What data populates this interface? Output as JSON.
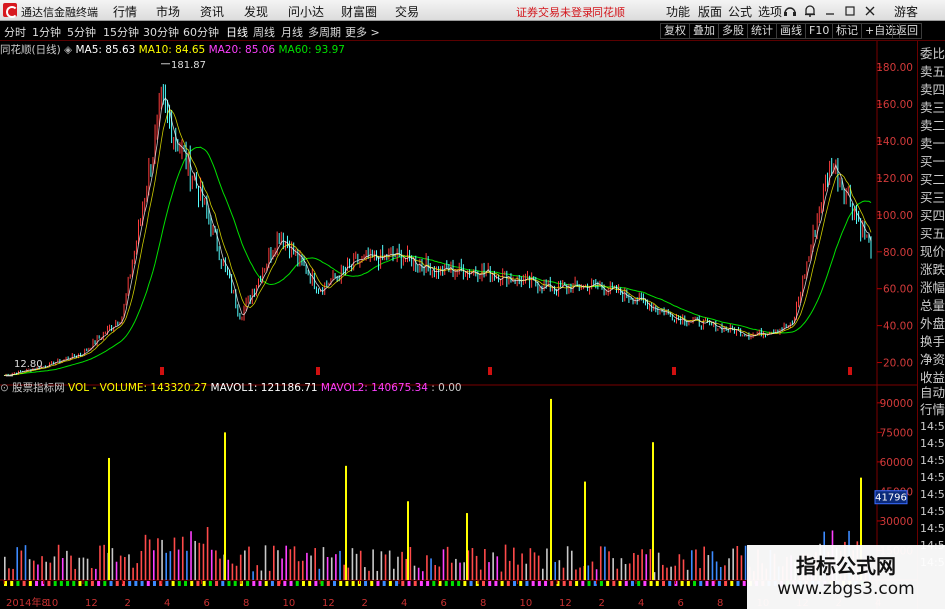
{
  "titlebar": {
    "app_name": "通达信金融终端",
    "menus": [
      "行情",
      "市场",
      "资讯",
      "发现",
      "问小达",
      "财富圈",
      "交易"
    ],
    "warning": "证券交易未登录",
    "warning_right": "同花顺",
    "right_items": [
      "功能",
      "版面",
      "公式",
      "选项"
    ],
    "guest": "游客"
  },
  "toolbar": {
    "periods": [
      "分时",
      "1分钟",
      "5分钟",
      "15分钟",
      "30分钟",
      "60分钟",
      "日线",
      "周线",
      "月线",
      "多周期",
      "更多 >"
    ],
    "active_period": "日线",
    "right_buttons": [
      "复权",
      "叠加",
      "多股",
      "统计",
      "画线",
      "F10",
      "标记",
      "+自选",
      "返回"
    ]
  },
  "main_info": {
    "stock_name": "同花顺(日线)",
    "ma5": "MA5: 85.63",
    "ma10": "MA10: 84.65",
    "ma20": "MA20: 85.06",
    "ma60": "MA60: 93.97",
    "high_marker": "181.87",
    "low_marker": "12.80"
  },
  "volume_info": {
    "indicator_name": "股票指标网",
    "vol": "VOL - VOLUME: 143320.27",
    "mavol1": "MAVOL1: 121186.71",
    "mavol2": "MAVOL2: 140675.34",
    "extra": ": 0.00",
    "current_volume_tag": "41796"
  },
  "price_axis": [
    "180.00",
    "160.00",
    "140.00",
    "120.00",
    "100.00",
    "80.00",
    "60.00",
    "40.00",
    "20.00"
  ],
  "volume_axis": [
    "90000",
    "75000",
    "60000",
    "45000",
    "30000",
    "15000"
  ],
  "date_axis": [
    "2014年8",
    "10",
    "12",
    "2",
    "4",
    "6",
    "8",
    "10",
    "12",
    "2",
    "4",
    "6",
    "8",
    "10",
    "12",
    "2",
    "4",
    "6",
    "8",
    "10",
    "12",
    "2",
    "4"
  ],
  "side_panel": {
    "top": [
      "委比",
      "卖五",
      "卖四",
      "卖三",
      "卖二",
      "卖一",
      "买一",
      "买二",
      "买三",
      "买四",
      "买五",
      "现价",
      "涨跌",
      "涨幅",
      "总量",
      "外盘",
      "换手",
      "净资",
      "收益"
    ],
    "bottom": [
      "自动",
      "行情",
      "14:5",
      "14:5",
      "14:5",
      "14:5",
      "14:5",
      "14:5",
      "14:5",
      "14:5",
      "14:5"
    ]
  },
  "watermark": {
    "title": "指标公式网",
    "url": "www.zbgs3.com"
  },
  "colors": {
    "up": "#ff3d3d",
    "down": "#54ffff",
    "ma5": "#ffffff",
    "ma10": "#ffff00",
    "ma20": "#ff40ff",
    "ma60": "#00e000",
    "vol_label": "#ffff00",
    "grid_red": "#7a0000"
  },
  "chart_data": {
    "type": "line",
    "title": "同花顺(日线)",
    "x": [
      "2014-08",
      "2014-10",
      "2014-12",
      "2015-02",
      "2015-04",
      "2015-06",
      "2015-08",
      "2015-10",
      "2015-12",
      "2016-02",
      "2016-04",
      "2016-06",
      "2016-08",
      "2016-10",
      "2016-12",
      "2017-02",
      "2017-04",
      "2017-06",
      "2017-08",
      "2017-10",
      "2017-12",
      "2018-02",
      "2018-04"
    ],
    "series": [
      {
        "values": [
          13,
          18,
          25,
          45,
          160,
          110,
          45,
          90,
          60,
          75,
          78,
          70,
          70,
          65,
          60,
          62,
          55,
          45,
          40,
          35,
          40,
          130,
          82
        ]
      }
    ],
    "ylim": [
      10,
      185
    ],
    "volume": {
      "ylim": [
        0,
        95000
      ],
      "current": 41796
    }
  }
}
